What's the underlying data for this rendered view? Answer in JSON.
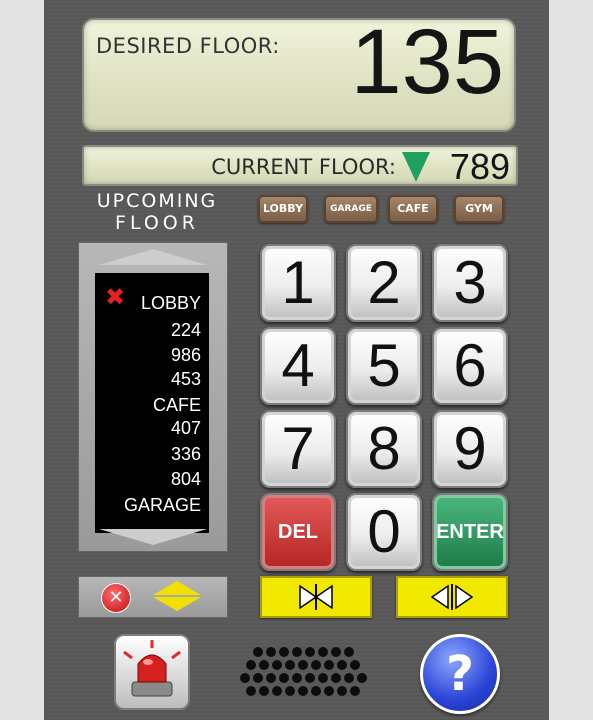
{
  "display": {
    "desired_label": "DESIRED FLOOR:",
    "desired_value": "135",
    "current_label": "CURRENT FLOOR:",
    "current_value": "789",
    "direction_icon": "down-arrow-icon"
  },
  "upcoming": {
    "title_line1": "UPCOMING",
    "title_line2": "FLOOR",
    "floors": [
      "LOBBY",
      "224",
      "986",
      "453",
      "CAFE",
      "407",
      "336",
      "804",
      "GARAGE"
    ]
  },
  "quick_buttons": [
    "LOBBY",
    "GARAGE",
    "CAFE",
    "GYM"
  ],
  "keypad": {
    "digits": [
      "1",
      "2",
      "3",
      "4",
      "5",
      "6",
      "7",
      "8",
      "9"
    ],
    "del_label": "DEL",
    "zero_label": "0",
    "enter_label": "ENTER"
  },
  "colors": {
    "panel": "#5a5a5a",
    "lcd": "#e2e5c6",
    "direction_arrow": "#20a060",
    "del_key": "#c43333",
    "enter_key": "#2a9a5c",
    "door_buttons": "#f1e800",
    "help_button": "#2a44d6"
  },
  "help_label": "?"
}
